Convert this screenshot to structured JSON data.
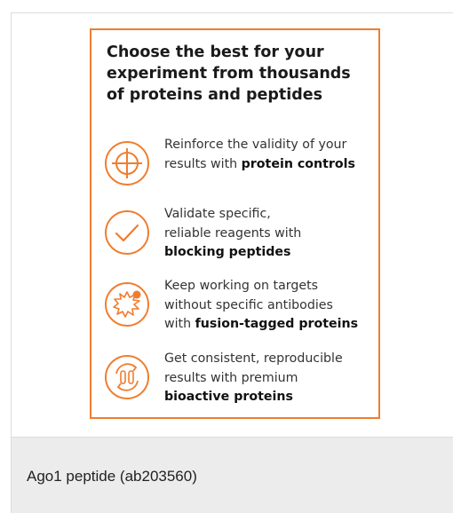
{
  "promo": {
    "title_lines": [
      "Choose the best for your",
      "experiment from thousands",
      "of proteins and peptides"
    ],
    "accent_color": "#f07d2e",
    "features": [
      {
        "icon": "crosshair-icon",
        "lines": [
          {
            "text": "Reinforce the validity of your"
          },
          {
            "pre": "results with ",
            "bold": "protein controls"
          }
        ]
      },
      {
        "icon": "checkmark-icon",
        "lines": [
          {
            "text": "Validate specific,"
          },
          {
            "text": "reliable reagents with"
          },
          {
            "bold": "blocking peptides"
          }
        ]
      },
      {
        "icon": "fusion-protein-icon",
        "lines": [
          {
            "text": "Keep working on targets"
          },
          {
            "text": "without specific antibodies"
          },
          {
            "pre": "with ",
            "bold": "fusion-tagged proteins"
          }
        ]
      },
      {
        "icon": "bioactive-cycle-icon",
        "lines": [
          {
            "text": "Get consistent, reproducible"
          },
          {
            "text": "results with premium"
          },
          {
            "bold": "bioactive proteins"
          }
        ]
      }
    ]
  },
  "caption": "Ago1 peptide (ab203560)"
}
